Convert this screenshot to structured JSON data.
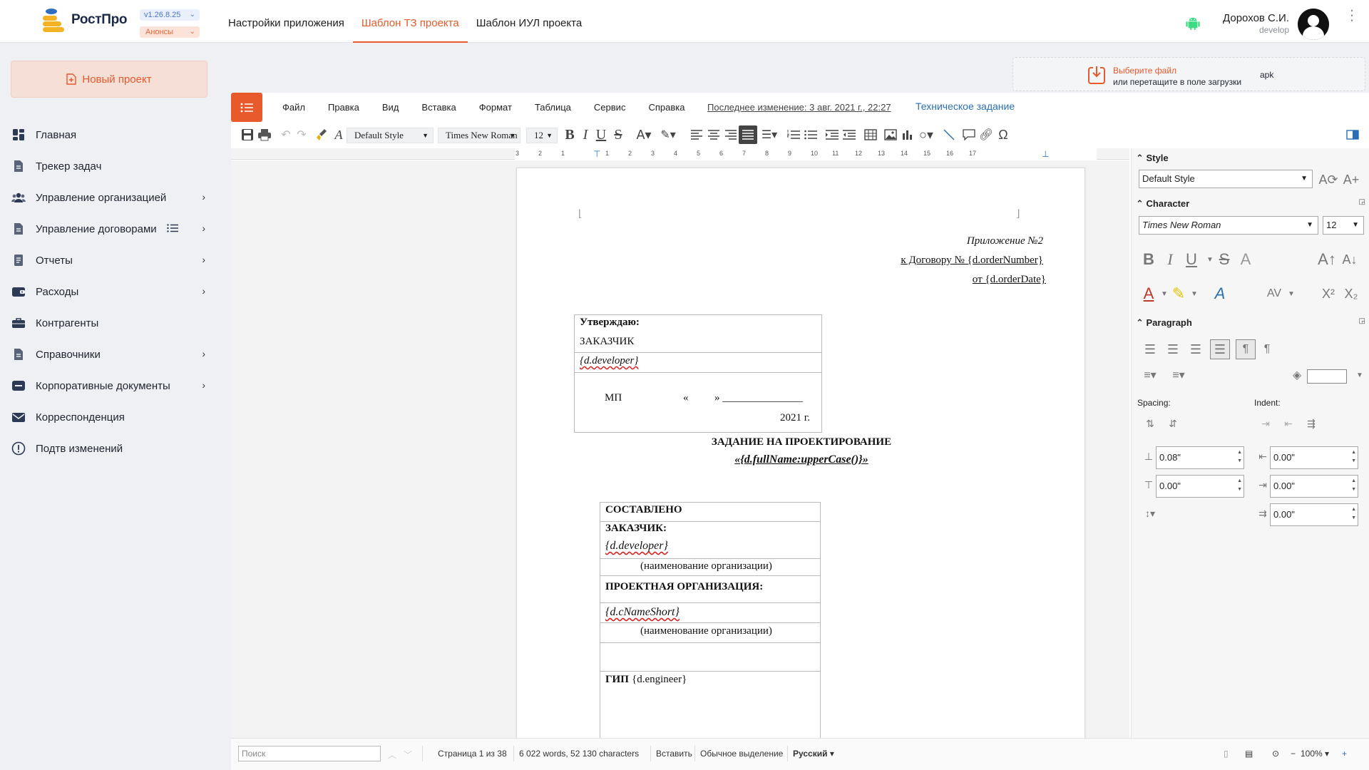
{
  "brand": {
    "name": "РостПро",
    "version": "v1.26.8.25",
    "announce": "Анонсы"
  },
  "top_tabs": [
    {
      "label": "Настройки приложения"
    },
    {
      "label": "Шаблон ТЗ проекта"
    },
    {
      "label": "Шаблон ИУЛ проекта"
    }
  ],
  "user": {
    "name": "Дорохов С.И.",
    "role": "develop"
  },
  "sidebar": {
    "new_project": "Новый проект",
    "items": [
      {
        "label": "Главная",
        "icon": "grid-icon"
      },
      {
        "label": "Трекер задач",
        "icon": "document-icon"
      },
      {
        "label": "Управление организацией",
        "icon": "people-icon"
      },
      {
        "label": "Управление договорами",
        "icon": "document-icon"
      },
      {
        "label": "Отчеты",
        "icon": "report-icon"
      },
      {
        "label": "Расходы",
        "icon": "wallet-icon"
      },
      {
        "label": "Контрагенты",
        "icon": "briefcase-icon"
      },
      {
        "label": "Справочники",
        "icon": "document-icon"
      },
      {
        "label": "Корпоративные документы",
        "icon": "minus-box-icon"
      },
      {
        "label": "Корреспонденция",
        "icon": "mail-icon"
      },
      {
        "label": "Подтв изменений",
        "icon": "info-icon"
      }
    ]
  },
  "upload": {
    "line1": "Выберите файл",
    "line2": "или перетащите в поле загрузки",
    "ext": "apk"
  },
  "editor": {
    "menu": [
      "Файл",
      "Правка",
      "Вид",
      "Вставка",
      "Формат",
      "Таблица",
      "Сервис",
      "Справка"
    ],
    "last_modified": "Последнее изменение:  3 авг. 2021 г., 22:27",
    "doc_name": "Техническое задание",
    "toolbar": {
      "style": "Default Style",
      "font": "Times New Roman",
      "size": "12"
    },
    "ruler": [
      "3",
      "2",
      "1",
      "1",
      "2",
      "3",
      "4",
      "5",
      "6",
      "7",
      "8",
      "9",
      "10",
      "11",
      "12",
      "13",
      "14",
      "15",
      "16",
      "17"
    ]
  },
  "document": {
    "appendix": "Приложение №2",
    "contract_ref": "к Договору № {d.orderNumber}",
    "contract_date": "от {d.orderDate}",
    "approve": {
      "title": "Утверждаю:",
      "customer": "ЗАКАЗЧИК",
      "developer": "{d.developer}",
      "stamp": "МП",
      "quote_open": "«",
      "quote_close": "» _______________",
      "year": "2021  г."
    },
    "heading": "ЗАДАНИЕ НА ПРОЕКТИРОВАНИЕ",
    "subheading": "«{d.fullName:upperCase()}»",
    "composed": {
      "title": "СОСТАВЛЕНО",
      "customer_label": "ЗАКАЗЧИК:",
      "customer_value": "{d.developer}",
      "org_note": "(наименование организации)",
      "design_org_label": "ПРОЕКТНАЯ ОРГАНИЗАЦИЯ:",
      "design_org_value": "{d.cNameShort}",
      "org_note2": "(наименование организации)",
      "gip_label": "ГИП",
      "gip_value": "{d.engineer}"
    }
  },
  "sidepanel": {
    "style_section": "Style",
    "style_value": "Default Style",
    "character_section": "Character",
    "font_value": "Times New Roman",
    "size_value": "12",
    "paragraph_section": "Paragraph",
    "spacing_label": "Spacing:",
    "indent_label": "Indent:",
    "spacing_above": "0.08\"",
    "spacing_below": "0.00\"",
    "indent_before": "0.00\"",
    "indent_after": "0.00\"",
    "indent_first": "0.00\""
  },
  "statusbar": {
    "search_placeholder": "Поиск",
    "page": "Страница 1 из 38",
    "words": "6 022 words, 52 130 characters",
    "insert_mode": "Вставить",
    "selection": "Обычное выделение",
    "language": "Русский",
    "zoom": "100%"
  },
  "colors": {
    "accent": "#e8592c",
    "link": "#2a6fb5",
    "android": "#3ddc84"
  }
}
